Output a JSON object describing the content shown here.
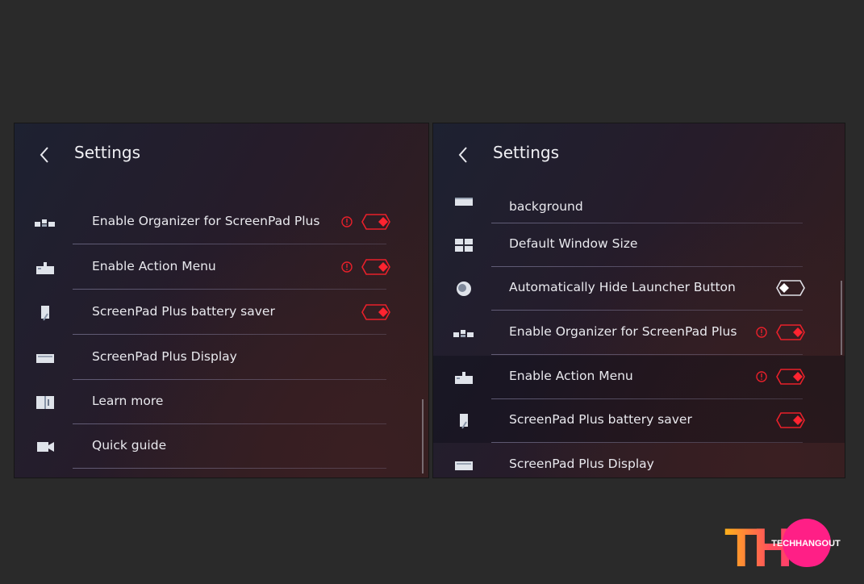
{
  "left_panel": {
    "title": "Settings",
    "items": [
      {
        "label": "Enable Organizer for ScreenPad Plus",
        "icon": "organizer-icon",
        "info": true,
        "toggle": "on"
      },
      {
        "label": "Enable Action Menu",
        "icon": "action-menu-icon",
        "info": true,
        "toggle": "on"
      },
      {
        "label": "ScreenPad Plus battery saver",
        "icon": "battery-saver-icon",
        "info": false,
        "toggle": "on"
      },
      {
        "label": "ScreenPad Plus Display",
        "icon": "display-icon",
        "info": false,
        "toggle": null
      },
      {
        "label": "Learn more",
        "icon": "book-icon",
        "info": false,
        "toggle": null
      },
      {
        "label": "Quick guide",
        "icon": "video-icon",
        "info": false,
        "toggle": null
      }
    ]
  },
  "right_panel": {
    "title": "Settings",
    "items": [
      {
        "label": "background",
        "icon": "background-icon",
        "info": false,
        "toggle": null
      },
      {
        "label": "Default Window Size",
        "icon": "window-size-icon",
        "info": false,
        "toggle": null
      },
      {
        "label": "Automatically Hide Launcher Button",
        "icon": "launcher-icon",
        "info": false,
        "toggle": "off"
      },
      {
        "label": "Enable Organizer for ScreenPad Plus",
        "icon": "organizer-icon",
        "info": true,
        "toggle": "on"
      },
      {
        "label": "Enable Action Menu",
        "icon": "action-menu-icon",
        "info": true,
        "toggle": "on"
      },
      {
        "label": "ScreenPad Plus battery saver",
        "icon": "battery-saver-icon",
        "info": false,
        "toggle": "on"
      },
      {
        "label": "ScreenPad Plus Display",
        "icon": "display-icon",
        "info": false,
        "toggle": null
      }
    ]
  },
  "logo": {
    "letters": "THO",
    "brand": "TECHHANGOUT"
  },
  "colors": {
    "accent": "#e8202a",
    "background": "#2a2a2a",
    "text": "#e9e9ee"
  }
}
